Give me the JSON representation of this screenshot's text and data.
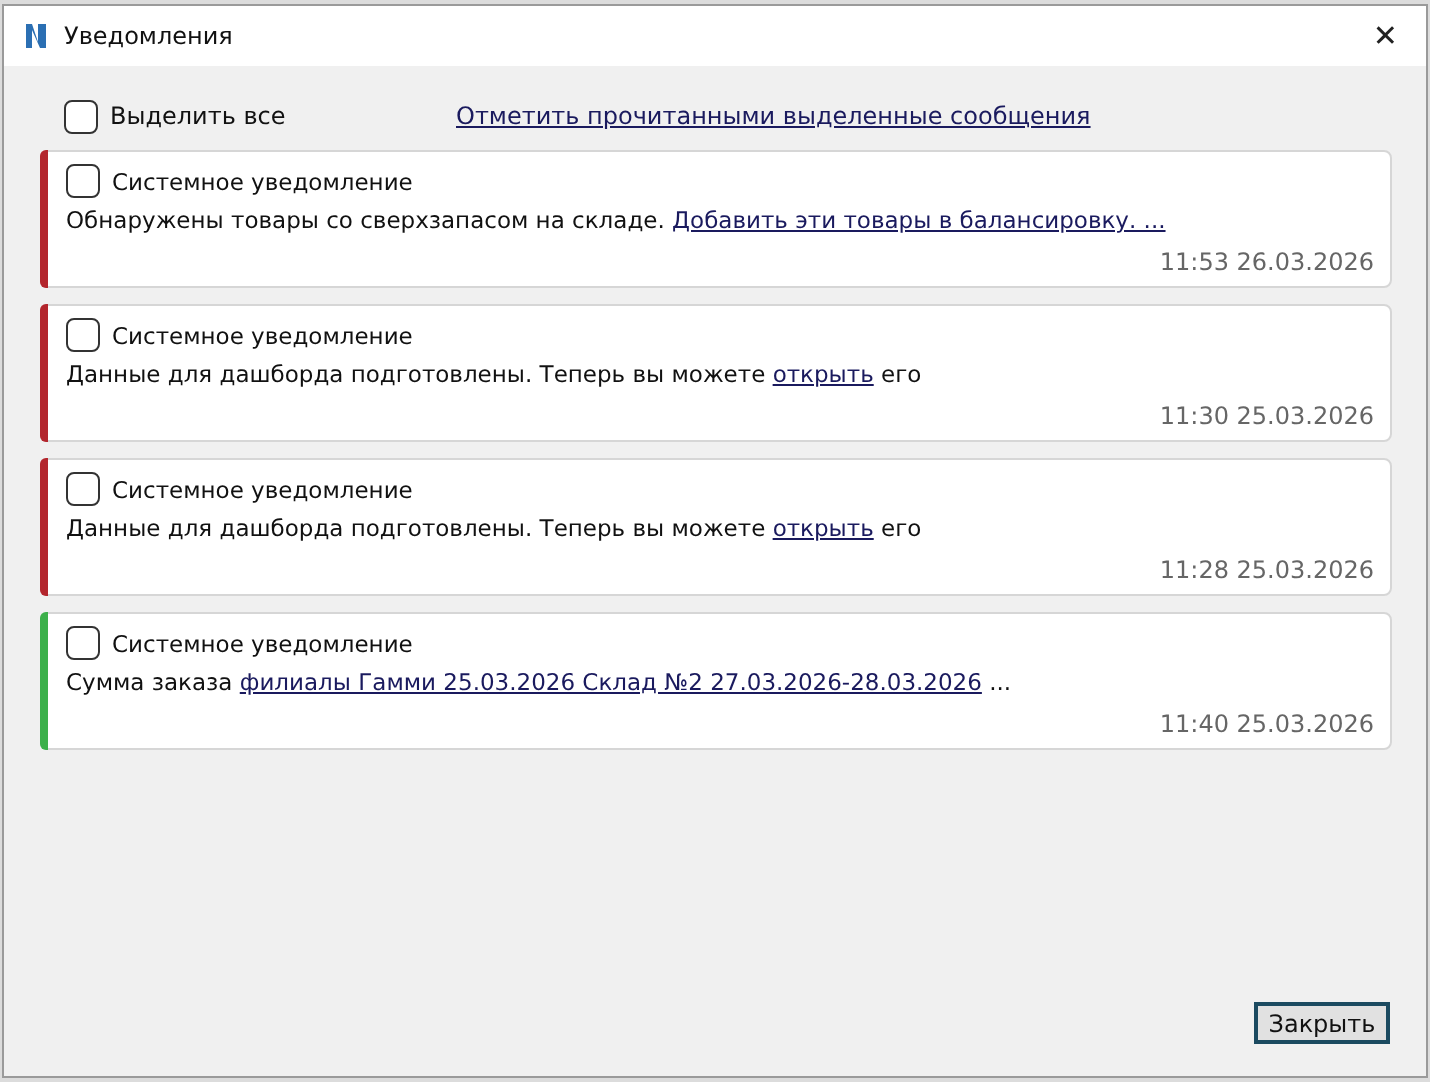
{
  "window": {
    "title": "Уведомления",
    "close": "✕"
  },
  "toolbar": {
    "select_all": {
      "label": "Выделить все",
      "checked": false
    },
    "mark_read_link": "Отметить прочитанными выделенные сообщения"
  },
  "notifications": [
    {
      "title": "Системное уведомление",
      "checked": false,
      "color": "#b3262d",
      "message": [
        {
          "kind": "text",
          "text": "Обнаружены товары со сверхзапасом на складе. "
        },
        {
          "kind": "link",
          "text": "Добавить эти товары в балансировку. ..."
        }
      ],
      "time": "11:53 26.03.2026"
    },
    {
      "title": "Системное уведомление",
      "checked": false,
      "color": "#b3262d",
      "message": [
        {
          "kind": "text",
          "text": "Данные для дашборда подготовлены. Теперь вы можете "
        },
        {
          "kind": "link",
          "text": "открыть"
        },
        {
          "kind": "text",
          "text": " его"
        }
      ],
      "time": "11:30 25.03.2026"
    },
    {
      "title": "Системное уведомление",
      "checked": false,
      "color": "#b3262d",
      "message": [
        {
          "kind": "text",
          "text": "Данные для дашборда подготовлены. Теперь вы можете "
        },
        {
          "kind": "link",
          "text": "открыть"
        },
        {
          "kind": "text",
          "text": " его"
        }
      ],
      "time": "11:28 25.03.2026"
    },
    {
      "title": "Системное уведомление",
      "checked": false,
      "color": "#3cb04a",
      "message": [
        {
          "kind": "text",
          "text": "Сумма заказа "
        },
        {
          "kind": "link",
          "text": "филиалы Гамми 25.03.2026 Склад №2 27.03.2026-28.03.2026"
        },
        {
          "kind": "text",
          "text": " ..."
        }
      ],
      "time": "11:40 25.03.2026"
    }
  ],
  "buttons": [
    {
      "label": "Закрыть"
    }
  ]
}
